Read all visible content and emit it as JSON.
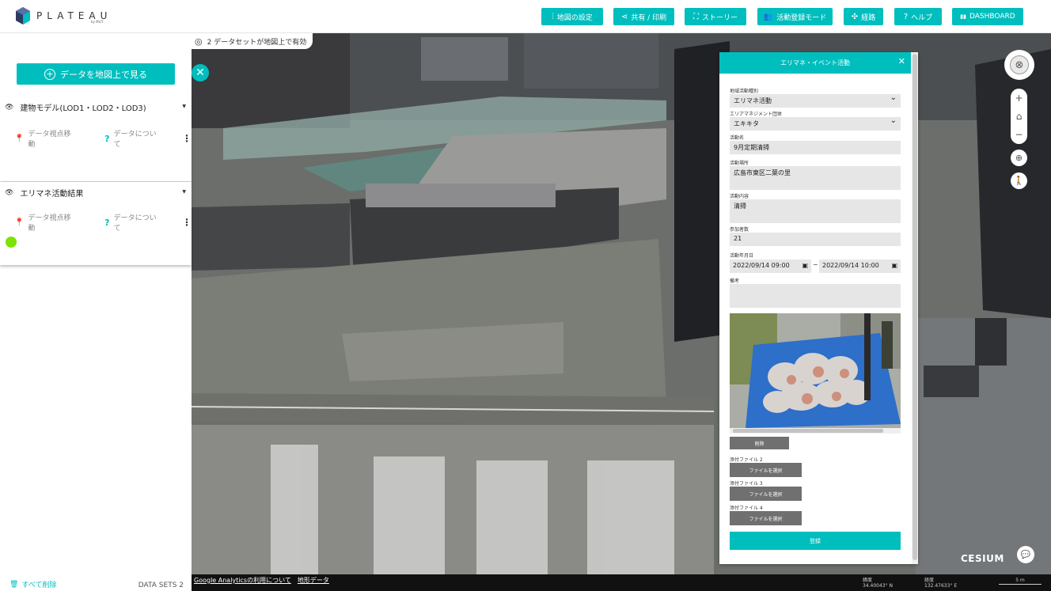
{
  "header": {
    "logo_text": "PLATEAU",
    "logo_sub": "by MLIT",
    "buttons": [
      {
        "icon": "sliders-icon",
        "glyph": "⫶",
        "label": "地図の設定"
      },
      {
        "icon": "share-icon",
        "glyph": "⋖",
        "label": "共有 / 印刷"
      },
      {
        "icon": "story-icon",
        "glyph": "⛶",
        "label": "ストーリー"
      },
      {
        "icon": "people-icon",
        "glyph": "👥",
        "label": "活動登録モード"
      },
      {
        "icon": "route-icon",
        "glyph": "✣",
        "label": "経路"
      },
      {
        "icon": "help-icon",
        "glyph": "?",
        "label": "ヘルプ"
      },
      {
        "icon": "dashboard-icon",
        "glyph": "▮▮",
        "label": "DASHBOARD"
      }
    ]
  },
  "sidebar": {
    "view_button": "データを地図上で見る",
    "layers": [
      {
        "title": "建物モデル(LOD1・LOD2・LOD3)",
        "move_label": "データ視点移動",
        "about_label": "データについて"
      },
      {
        "title": "エリマネ活動結果",
        "move_label": "データ視点移動",
        "about_label": "データについて"
      }
    ],
    "clear_all": "すべて削除",
    "datasets_count": "DATA SETS 2"
  },
  "map": {
    "datasets_note": "2 データセットが地図上で有効",
    "footer_links": [
      "Google Analyticsの利用について",
      "地形データ"
    ],
    "lat_label": "緯度",
    "lat_value": "34.40043° N",
    "lng_label": "経度",
    "lng_value": "132.47633° E",
    "scale_label": "5 m",
    "cesium_label": "CESIUM"
  },
  "panel": {
    "title": "エリマネ・イベント活動",
    "fields": {
      "activity_type_label": "地域活動種別",
      "activity_type_value": "エリマネ活動",
      "organization_label": "エリアマネジメント団体",
      "organization_value": "エキキタ",
      "name_label": "活動名",
      "name_value": "9月定期清掃",
      "place_label": "活動場所",
      "place_value": "広島市東区二葉の里",
      "content_label": "活動内容",
      "content_value": "清掃",
      "participants_label": "参加者数",
      "participants_value": "21",
      "datetime_label": "活動年月日",
      "start_value": "2022/09/14 09:00",
      "end_value": "2022/09/14 10:00",
      "tilde": "~",
      "notes_label": "備考",
      "notes_value": ""
    },
    "delete_button": "削除",
    "attachments": [
      {
        "label": "添付ファイル 2",
        "button": "ファイルを選択"
      },
      {
        "label": "添付ファイル 3",
        "button": "ファイルを選択"
      },
      {
        "label": "添付ファイル 4",
        "button": "ファイルを選択"
      }
    ],
    "submit_button": "登録"
  },
  "colors": {
    "accent": "#00bebe",
    "marker": "#7de300"
  }
}
